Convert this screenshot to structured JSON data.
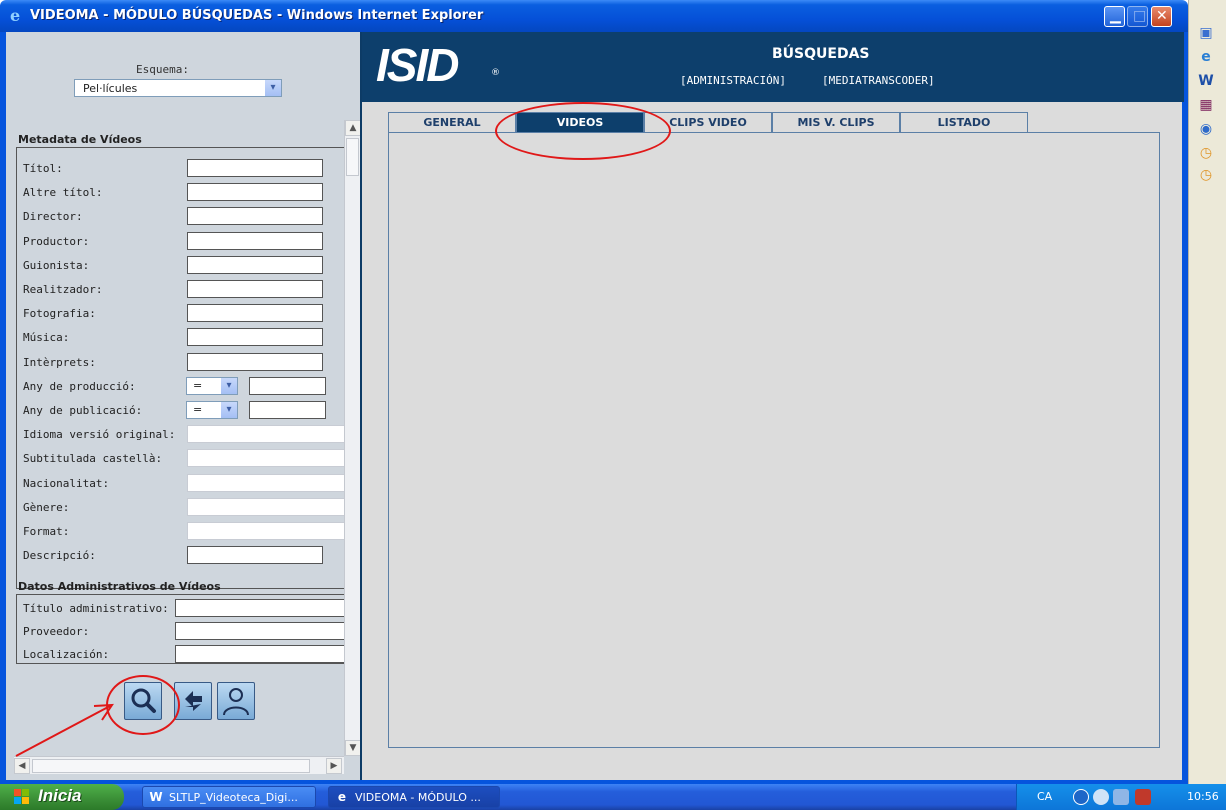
{
  "window": {
    "title": "VIDEOMA - MÓDULO BÚSQUEDAS - Windows Internet Explorer",
    "min_glyph": "▁",
    "max_glyph": "□",
    "close_glyph": "✕"
  },
  "left_panel": {
    "scheme_label": "Esquema:",
    "scheme_value": "Pel·lícules",
    "metadata_title": "Metadata de Vídeos",
    "metadata_fields": [
      {
        "label": "Títol:",
        "kind": "text"
      },
      {
        "label": "Altre títol:",
        "kind": "text"
      },
      {
        "label": "Director:",
        "kind": "text"
      },
      {
        "label": "Productor:",
        "kind": "text"
      },
      {
        "label": "Guionista:",
        "kind": "text"
      },
      {
        "label": "Realitzador:",
        "kind": "text"
      },
      {
        "label": "Fotografia:",
        "kind": "text"
      },
      {
        "label": "Música:",
        "kind": "text"
      },
      {
        "label": "Intèrprets:",
        "kind": "text"
      },
      {
        "label": "Any de producció:",
        "kind": "year",
        "operator": "="
      },
      {
        "label": "Any de publicació:",
        "kind": "year",
        "operator": "="
      },
      {
        "label": "Idioma versió original:",
        "kind": "select"
      },
      {
        "label": "Subtitulada castellà:",
        "kind": "select"
      },
      {
        "label": "Nacionalitat:",
        "kind": "select"
      },
      {
        "label": "Gènere:",
        "kind": "select"
      },
      {
        "label": "Format:",
        "kind": "select"
      },
      {
        "label": "Descripció:",
        "kind": "text"
      }
    ],
    "admin_title": "Datos Administrativos de Vídeos",
    "admin_fields": [
      {
        "label": "Título administrativo:"
      },
      {
        "label": "Proveedor:"
      },
      {
        "label": "Localización:"
      }
    ],
    "actions": [
      "search-icon",
      "refresh-icon",
      "user-icon"
    ]
  },
  "header": {
    "logo": "ISID",
    "logo_reg": "®",
    "section_title": "BÚSQUEDAS",
    "link_admin": "[ADMINISTRACIÓN]",
    "link_media": "[MEDIATRANSCODER]"
  },
  "tabs": [
    {
      "label": "GENERAL",
      "active": false
    },
    {
      "label": "VIDEOS",
      "active": true
    },
    {
      "label": "CLIPS VIDEO",
      "active": false
    },
    {
      "label": "MIS V. CLIPS",
      "active": false
    },
    {
      "label": "LISTADO",
      "active": false
    }
  ],
  "taskbar": {
    "start_label": "Inicia",
    "items": [
      {
        "label": "SLTLP_Videoteca_Digi...",
        "icon": "word-icon",
        "active": false
      },
      {
        "label": "VIDEOMA - MÓDULO ...",
        "icon": "ie-icon",
        "active": true
      }
    ],
    "lang": "CA",
    "clock": "10:56"
  },
  "colors": {
    "header_bg": "#0d3f6c",
    "annotation_red": "#e01818",
    "panel_bg": "#cfd6dd"
  }
}
